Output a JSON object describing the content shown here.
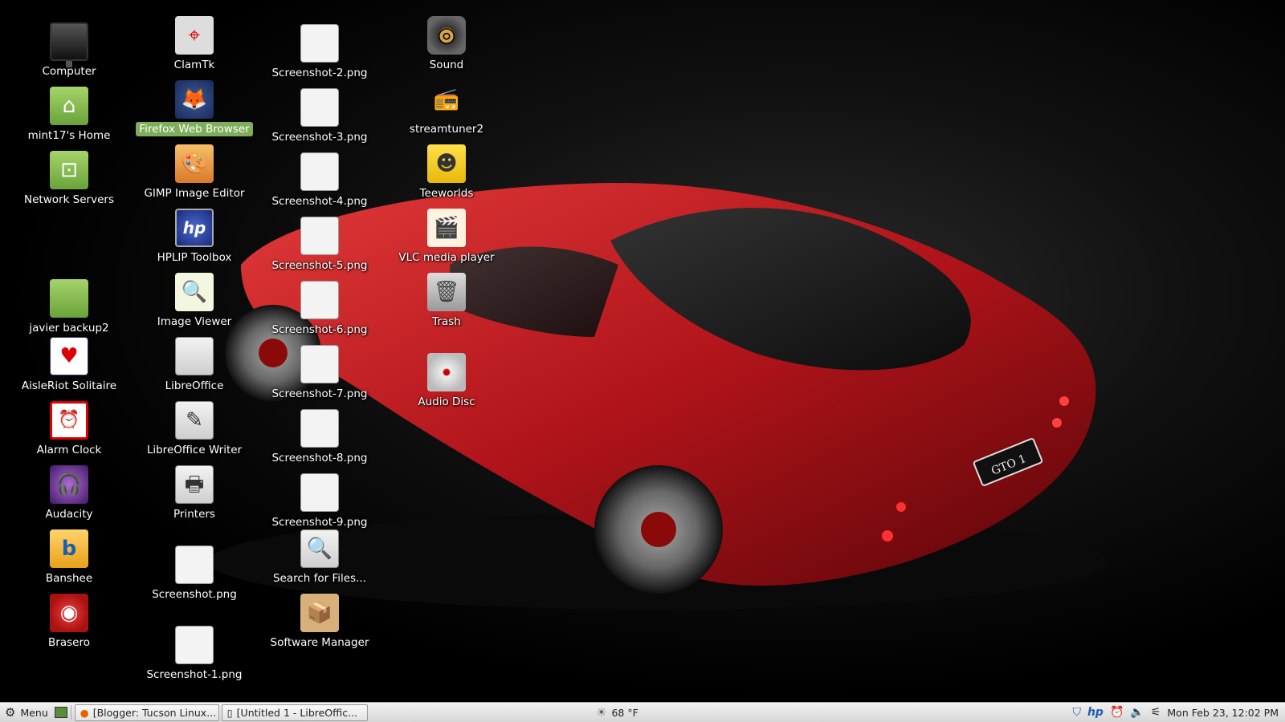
{
  "desktop": {
    "icons": [
      {
        "label": "Computer",
        "icon": "computer-icon"
      },
      {
        "label": "mint17's Home",
        "icon": "home-folder-icon"
      },
      {
        "label": "Network Servers",
        "icon": "network-folder-icon"
      },
      {
        "label": "javier backup2",
        "icon": "folder-icon"
      },
      {
        "label": "AisleRiot Solitaire",
        "icon": "cards-icon"
      },
      {
        "label": "Alarm Clock",
        "icon": "alarm-clock-icon"
      },
      {
        "label": "Audacity",
        "icon": "headphones-icon"
      },
      {
        "label": "Banshee",
        "icon": "banshee-icon"
      },
      {
        "label": "Brasero",
        "icon": "disc-burner-icon"
      },
      {
        "label": "ClamTk",
        "icon": "crosshair-icon"
      },
      {
        "label": "Firefox Web Browser",
        "icon": "firefox-icon",
        "selected": true
      },
      {
        "label": "GIMP Image Editor",
        "icon": "gimp-icon"
      },
      {
        "label": "HPLIP Toolbox",
        "icon": "hp-icon"
      },
      {
        "label": "Image Viewer",
        "icon": "magnifier-image-icon"
      },
      {
        "label": "LibreOffice",
        "icon": "document-icon"
      },
      {
        "label": "LibreOffice Writer",
        "icon": "writer-icon"
      },
      {
        "label": "Printers",
        "icon": "printer-icon"
      },
      {
        "label": "Screenshot.png",
        "icon": "image-file-icon"
      },
      {
        "label": "Screenshot-1.png",
        "icon": "image-file-icon"
      },
      {
        "label": "Screenshot-2.png",
        "icon": "image-file-icon"
      },
      {
        "label": "Screenshot-3.png",
        "icon": "image-file-icon"
      },
      {
        "label": "Screenshot-4.png",
        "icon": "image-file-icon"
      },
      {
        "label": "Screenshot-5.png",
        "icon": "image-file-icon"
      },
      {
        "label": "Screenshot-6.png",
        "icon": "image-file-icon"
      },
      {
        "label": "Screenshot-7.png",
        "icon": "image-file-icon"
      },
      {
        "label": "Screenshot-8.png",
        "icon": "image-file-icon"
      },
      {
        "label": "Screenshot-9.png",
        "icon": "image-file-icon"
      },
      {
        "label": "Search for Files...",
        "icon": "search-icon"
      },
      {
        "label": "Software Manager",
        "icon": "package-icon"
      },
      {
        "label": "Sound",
        "icon": "speaker-icon"
      },
      {
        "label": "streamtuner2",
        "icon": "radio-icon"
      },
      {
        "label": "Teeworlds",
        "icon": "teeworlds-icon"
      },
      {
        "label": "VLC media player",
        "icon": "vlc-icon"
      },
      {
        "label": "Trash",
        "icon": "trash-icon"
      },
      {
        "label": "Audio Disc",
        "icon": "audio-disc-icon"
      }
    ]
  },
  "taskbar": {
    "menu_label": "Menu",
    "windows": [
      {
        "label": "[Blogger: Tucson Linux...",
        "icon": "firefox-icon"
      },
      {
        "label": "[Untitled 1 - LibreOffic...",
        "icon": "document-icon"
      }
    ],
    "weather": "68 °F",
    "clock": "Mon Feb 23, 12:02 PM"
  }
}
